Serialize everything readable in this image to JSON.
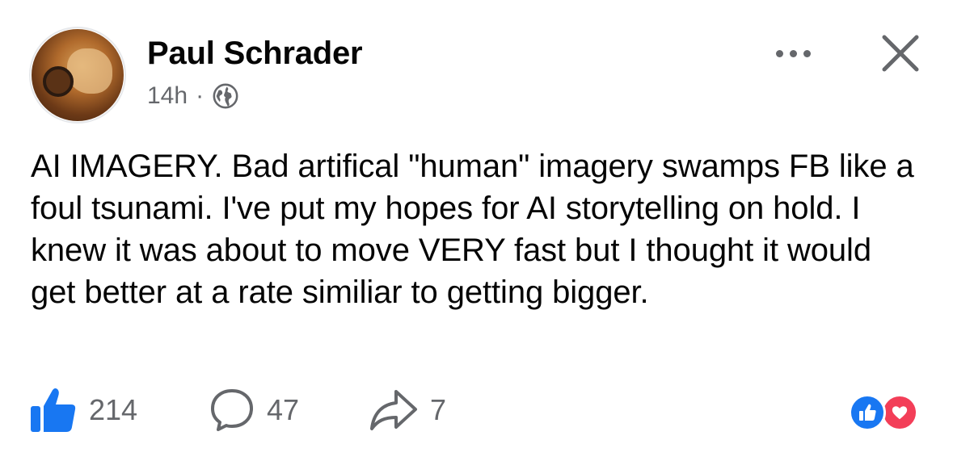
{
  "post": {
    "author": "Paul Schrader",
    "timestamp": "14h",
    "separator": "·",
    "audience_icon": "globe-icon",
    "text": "AI IMAGERY. Bad artifical \"human\" imagery swamps FB like a foul tsunami. I've put my hopes for AI storytelling on hold. I knew it was about to move VERY fast but I thought it would get better at a rate similiar to getting bigger."
  },
  "header": {
    "more_icon": "more-options-icon",
    "close_icon": "close-icon"
  },
  "footer": {
    "likes": "214",
    "comments": "47",
    "shares": "7",
    "reactions": [
      "like-reaction-icon",
      "love-reaction-icon"
    ]
  },
  "colors": {
    "brand_blue": "#1877f2",
    "love_red": "#f33e58",
    "text_primary": "#050505",
    "text_secondary": "#65676b"
  }
}
